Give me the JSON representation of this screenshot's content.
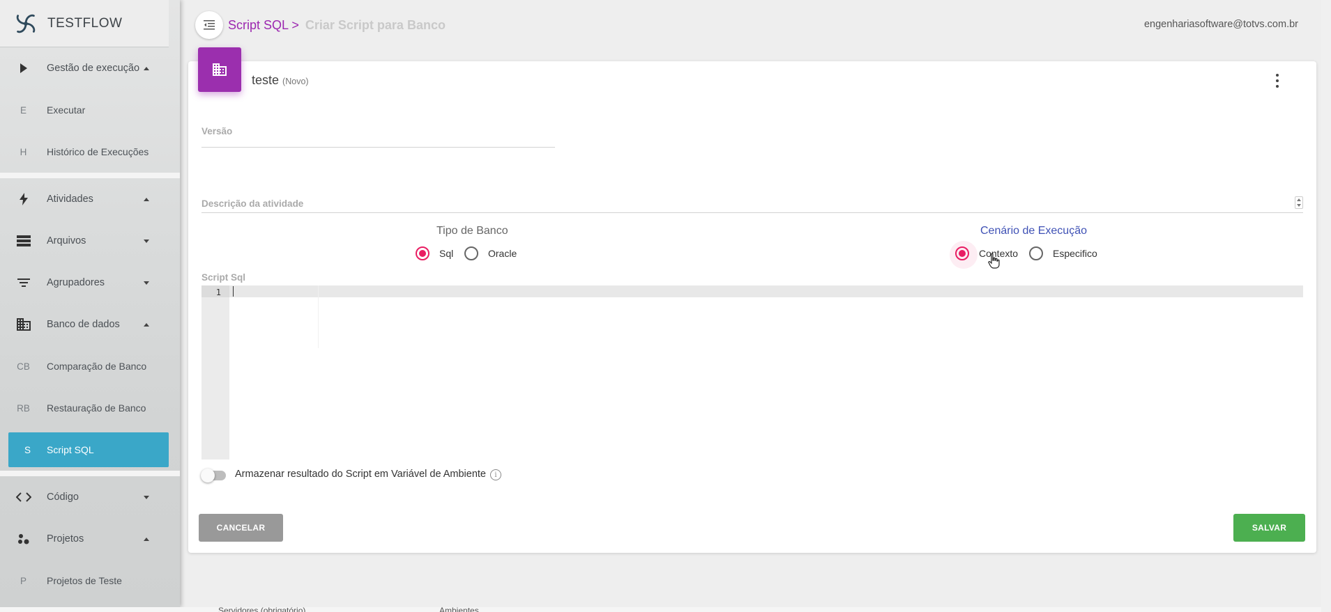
{
  "app": {
    "name": "TESTFLOW",
    "user_email": "engenhariasoftware@totvs.com.br"
  },
  "sidebar": {
    "sections": [
      {
        "label": "Gestão de execução",
        "icon": "play-icon",
        "expanded": true
      },
      {
        "label": "Atividades",
        "icon": "bolt-icon",
        "expanded": true
      },
      {
        "label": "Arquivos",
        "icon": "storage-icon",
        "expanded": false
      },
      {
        "label": "Agrupadores",
        "icon": "filter-icon",
        "expanded": false
      },
      {
        "label": "Banco de dados",
        "icon": "building-icon",
        "expanded": true
      },
      {
        "label": "Código",
        "icon": "code-icon",
        "expanded": false
      },
      {
        "label": "Projetos",
        "icon": "bubbles-icon",
        "expanded": true
      }
    ],
    "sub_items": [
      {
        "abbr": "E",
        "label": "Executar"
      },
      {
        "abbr": "H",
        "label": "Histórico de Execuções"
      },
      {
        "abbr": "CB",
        "label": "Comparação de Banco"
      },
      {
        "abbr": "RB",
        "label": "Restauração de Banco"
      },
      {
        "abbr": "S",
        "label": "Script SQL",
        "active": true
      },
      {
        "abbr": "P",
        "label": "Projetos de Teste"
      }
    ]
  },
  "breadcrumb": {
    "parent": "Script SQL >",
    "current": "Criar Script para Banco"
  },
  "card": {
    "title": "teste",
    "status": "(Novo)"
  },
  "form": {
    "version_label": "Versão",
    "description_label": "Descrição da atividade",
    "db_type": {
      "title": "Tipo de Banco",
      "options": [
        "Sql",
        "Oracle"
      ],
      "selected": "Sql"
    },
    "scenario": {
      "title": "Cenário de Execução",
      "options": [
        "Contexto",
        "Especifico"
      ],
      "selected": "Contexto"
    },
    "script_label": "Script Sql",
    "editor_line": "1",
    "store_result_label": "Armazenar resultado do Script em Variável de Ambiente",
    "store_result_enabled": false
  },
  "buttons": {
    "cancel": "CANCELAR",
    "save": "SALVAR"
  },
  "footer": {
    "left": "Servidores (obrigatório)",
    "right": "Ambientes"
  },
  "colors": {
    "accent": "#9c27b0",
    "active_nav": "#3aa7c8",
    "radio_on": "#e91e63",
    "save": "#4caf50",
    "cancel": "#999999",
    "scenario_title": "#3f51b5"
  }
}
